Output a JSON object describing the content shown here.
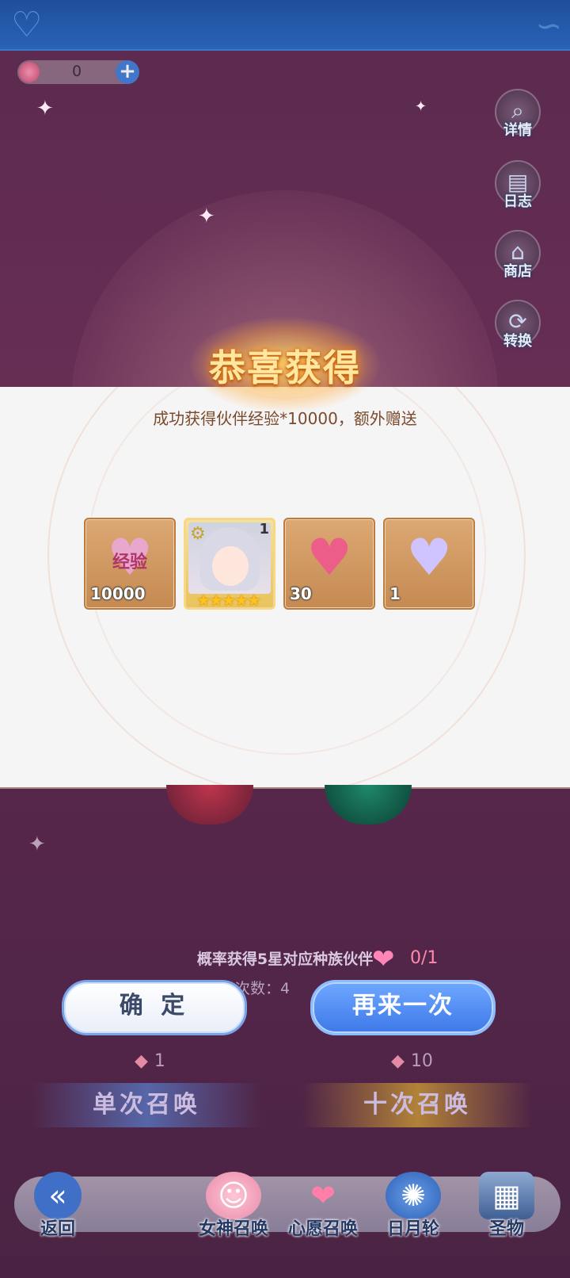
{
  "currency": {
    "amount": "0"
  },
  "side_menu": {
    "details": "详情",
    "log": "日志",
    "shop": "商店",
    "convert": "转换"
  },
  "dialog": {
    "title": "恭喜获得",
    "subtitle": "成功获得伙伴经验*10000，额外赠送",
    "rewards": [
      {
        "icon": "exp-heart-icon",
        "label": "经验",
        "qty": "10000"
      },
      {
        "icon": "character-portrait",
        "level": "1",
        "stars": "★★★★★"
      },
      {
        "icon": "pink-heart-icon",
        "qty": "30"
      },
      {
        "icon": "crystal-heart-icon",
        "qty": "1"
      }
    ]
  },
  "summon": {
    "probability_text": "概率获得5星对应种族伙伴",
    "wish_count": "0/1",
    "times_text": "唤次数：4",
    "single_cost": "1",
    "ten_cost": "10",
    "single_label": "单次召唤",
    "ten_label": "十次召唤"
  },
  "buttons": {
    "confirm": "确 定",
    "again": "再来一次"
  },
  "nav": {
    "back": "返回",
    "goddess": "女神召唤",
    "wish": "心愿召唤",
    "wheel": "日月轮",
    "relic": "圣物"
  }
}
